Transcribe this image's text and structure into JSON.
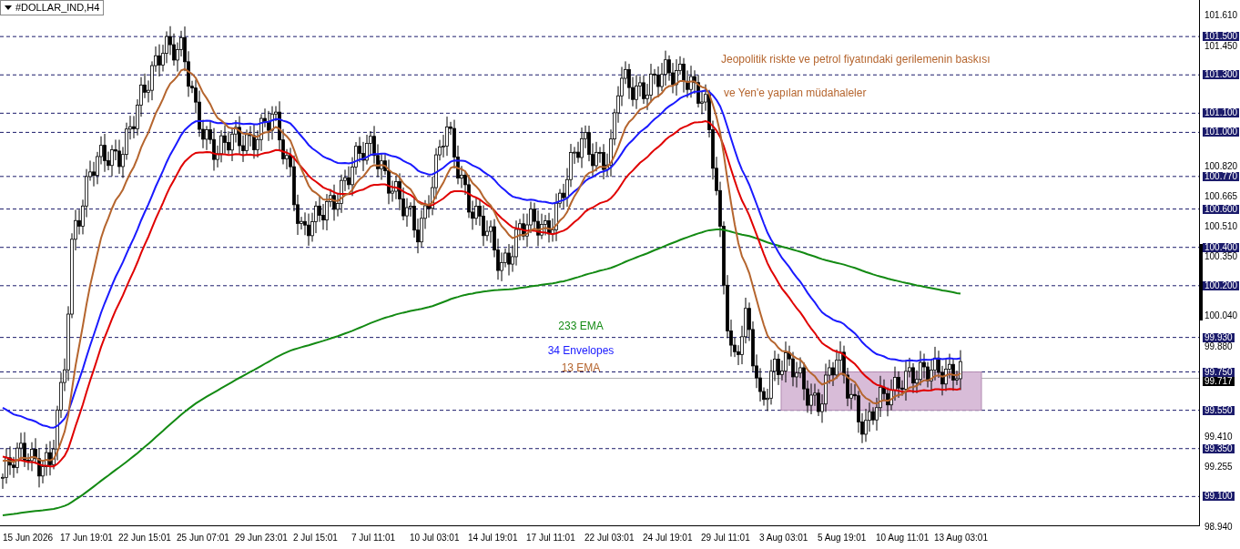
{
  "chart_title": "#DOLLAR_IND,H4",
  "annotations": [
    {
      "text": "Jeopolitik riskte ve petrol fiyatındaki gerilemenin baskısı"
    },
    {
      "text": "ve Yen'e yapılan müdahaleler"
    }
  ],
  "legend": [
    {
      "text": "233 EMA",
      "color": "#138a13"
    },
    {
      "text": "34 Envelopes",
      "color": "#1a1aff"
    },
    {
      "text": "13 EMA",
      "color": "#b5652e"
    }
  ],
  "price_axis": [
    {
      "text": "101.610",
      "kind": "tick"
    },
    {
      "text": "101.500",
      "kind": "level"
    },
    {
      "text": "101.450",
      "kind": "tick"
    },
    {
      "text": "101.300",
      "kind": "level"
    },
    {
      "text": "101.100",
      "kind": "level"
    },
    {
      "text": "101.000",
      "kind": "level"
    },
    {
      "text": "100.820",
      "kind": "tick"
    },
    {
      "text": "100.770",
      "kind": "level"
    },
    {
      "text": "100.665",
      "kind": "tick"
    },
    {
      "text": "100.600",
      "kind": "level"
    },
    {
      "text": "100.510",
      "kind": "tick"
    },
    {
      "text": "100.400",
      "kind": "level"
    },
    {
      "text": "100.350",
      "kind": "tick"
    },
    {
      "text": "100.200",
      "kind": "level"
    },
    {
      "text": "100.040",
      "kind": "tick"
    },
    {
      "text": "99.930",
      "kind": "level"
    },
    {
      "text": "99.880",
      "kind": "tick"
    },
    {
      "text": "99.750",
      "kind": "level"
    },
    {
      "text": "99.717",
      "kind": "current"
    },
    {
      "text": "99.550",
      "kind": "level"
    },
    {
      "text": "99.410",
      "kind": "tick"
    },
    {
      "text": "99.350",
      "kind": "level"
    },
    {
      "text": "99.255",
      "kind": "tick"
    },
    {
      "text": "99.100",
      "kind": "level"
    },
    {
      "text": "98.940",
      "kind": "tick"
    }
  ],
  "time_axis": [
    "15 Jun 2026",
    "17 Jun 19:01",
    "22 Jun 15:01",
    "25 Jun 07:01",
    "29 Jun 23:01",
    "2 Jul 15:01",
    "7 Jul 11:01",
    "10 Jul 03:01",
    "14 Jul 19:01",
    "17 Jul 11:01",
    "22 Jul 03:01",
    "24 Jul 19:01",
    "29 Jul 11:01",
    "3 Aug 03:01",
    "5 Aug 19:01",
    "10 Aug 11:01",
    "13 Aug 03:01"
  ]
}
